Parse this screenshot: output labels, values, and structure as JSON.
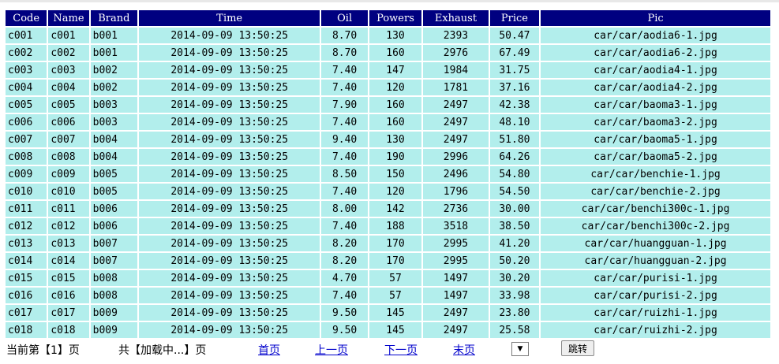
{
  "table": {
    "columns": [
      "Code",
      "Name",
      "Brand",
      "Time",
      "Oil",
      "Powers",
      "Exhaust",
      "Price",
      "Pic"
    ],
    "rows": [
      [
        "c001",
        "c001",
        "b001",
        "2014-09-09 13:50:25",
        "8.70",
        "130",
        "2393",
        "50.47",
        "car/car/aodia6-1.jpg"
      ],
      [
        "c002",
        "c002",
        "b001",
        "2014-09-09 13:50:25",
        "8.70",
        "160",
        "2976",
        "67.49",
        "car/car/aodia6-2.jpg"
      ],
      [
        "c003",
        "c003",
        "b002",
        "2014-09-09 13:50:25",
        "7.40",
        "147",
        "1984",
        "31.75",
        "car/car/aodia4-1.jpg"
      ],
      [
        "c004",
        "c004",
        "b002",
        "2014-09-09 13:50:25",
        "7.40",
        "120",
        "1781",
        "37.16",
        "car/car/aodia4-2.jpg"
      ],
      [
        "c005",
        "c005",
        "b003",
        "2014-09-09 13:50:25",
        "7.90",
        "160",
        "2497",
        "42.38",
        "car/car/baoma3-1.jpg"
      ],
      [
        "c006",
        "c006",
        "b003",
        "2014-09-09 13:50:25",
        "7.40",
        "160",
        "2497",
        "48.10",
        "car/car/baoma3-2.jpg"
      ],
      [
        "c007",
        "c007",
        "b004",
        "2014-09-09 13:50:25",
        "9.40",
        "130",
        "2497",
        "51.80",
        "car/car/baoma5-1.jpg"
      ],
      [
        "c008",
        "c008",
        "b004",
        "2014-09-09 13:50:25",
        "7.40",
        "190",
        "2996",
        "64.26",
        "car/car/baoma5-2.jpg"
      ],
      [
        "c009",
        "c009",
        "b005",
        "2014-09-09 13:50:25",
        "8.50",
        "150",
        "2496",
        "54.80",
        "car/car/benchie-1.jpg"
      ],
      [
        "c010",
        "c010",
        "b005",
        "2014-09-09 13:50:25",
        "7.40",
        "120",
        "1796",
        "54.50",
        "car/car/benchie-2.jpg"
      ],
      [
        "c011",
        "c011",
        "b006",
        "2014-09-09 13:50:25",
        "8.00",
        "142",
        "2736",
        "30.00",
        "car/car/benchi300c-1.jpg"
      ],
      [
        "c012",
        "c012",
        "b006",
        "2014-09-09 13:50:25",
        "7.40",
        "188",
        "3518",
        "38.50",
        "car/car/benchi300c-2.jpg"
      ],
      [
        "c013",
        "c013",
        "b007",
        "2014-09-09 13:50:25",
        "8.20",
        "170",
        "2995",
        "41.20",
        "car/car/huangguan-1.jpg"
      ],
      [
        "c014",
        "c014",
        "b007",
        "2014-09-09 13:50:25",
        "8.20",
        "170",
        "2995",
        "50.20",
        "car/car/huangguan-2.jpg"
      ],
      [
        "c015",
        "c015",
        "b008",
        "2014-09-09 13:50:25",
        "4.70",
        "57",
        "1497",
        "30.20",
        "car/car/purisi-1.jpg"
      ],
      [
        "c016",
        "c016",
        "b008",
        "2014-09-09 13:50:25",
        "7.40",
        "57",
        "1497",
        "33.98",
        "car/car/purisi-2.jpg"
      ],
      [
        "c017",
        "c017",
        "b009",
        "2014-09-09 13:50:25",
        "9.50",
        "145",
        "2497",
        "23.80",
        "car/car/ruizhi-1.jpg"
      ],
      [
        "c018",
        "c018",
        "b009",
        "2014-09-09 13:50:25",
        "9.50",
        "145",
        "2497",
        "25.58",
        "car/car/ruizhi-2.jpg"
      ]
    ]
  },
  "pager": {
    "current_page": "当前第【1】页",
    "total": "共【加载中...】页",
    "first": "首页",
    "prev": "上一页",
    "next": "下一页",
    "last": "末页",
    "page_select_value": "",
    "dropdown_arrow": "▼",
    "jump_button": "跳转"
  },
  "colors": {
    "header_bg": "#000080",
    "header_text": "#ffffff",
    "cell_bg": "#b2eeec",
    "link": "#0000cc"
  },
  "icons": {
    "dropdown": "chevron-down-icon"
  }
}
